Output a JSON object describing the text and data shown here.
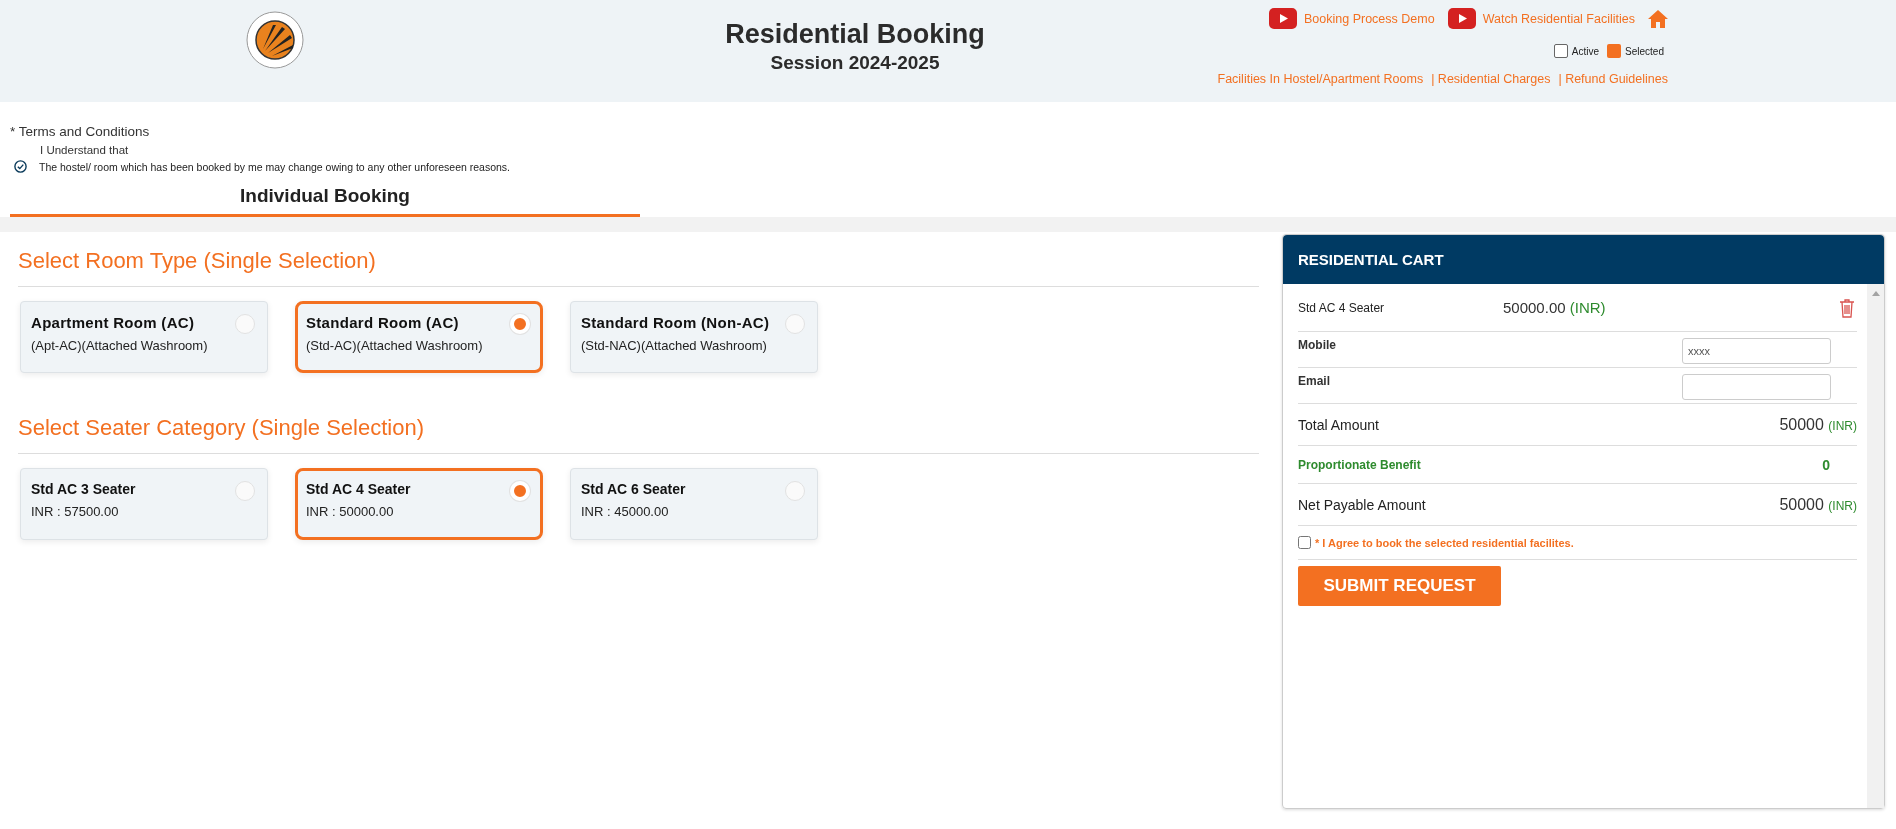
{
  "header": {
    "title": "Residential Booking",
    "subtitle": "Session 2024-2025",
    "video_links": [
      {
        "label": "Booking Process Demo"
      },
      {
        "label": "Watch Residential Facilities"
      }
    ],
    "legend": [
      {
        "label": "Active",
        "kind": "active"
      },
      {
        "label": "Selected",
        "kind": "selected"
      }
    ],
    "info_links": [
      "Facilities In Hostel/Apartment Rooms",
      "| Residential Charges",
      "| Refund Guidelines"
    ]
  },
  "terms": {
    "title": "* Terms and Conditions",
    "intro": "I Understand that",
    "items": [
      "The hostel/ room which has been booked by me may change owing to any other unforeseen reasons."
    ]
  },
  "tabs": [
    {
      "label": "Individual Booking",
      "selected": true
    }
  ],
  "room_type": {
    "heading": "Select Room Type (Single Selection)",
    "options": [
      {
        "title": "Apartment Room (AC)",
        "subtitle": "(Apt-AC)(Attached Washroom)",
        "selected": false
      },
      {
        "title": "Standard Room (AC)",
        "subtitle": "(Std-AC)(Attached Washroom)",
        "selected": true
      },
      {
        "title": "Standard Room (Non-AC)",
        "subtitle": "(Std-NAC)(Attached Washroom)",
        "selected": false
      }
    ]
  },
  "seater": {
    "heading": "Select Seater Category (Single Selection)",
    "options": [
      {
        "title": "Std AC 3 Seater",
        "subtitle": "INR : 57500.00",
        "selected": false
      },
      {
        "title": "Std AC 4 Seater",
        "subtitle": "INR : 50000.00",
        "selected": true
      },
      {
        "title": "Std AC 6 Seater",
        "subtitle": "INR : 45000.00",
        "selected": false
      }
    ]
  },
  "cart": {
    "title": "RESIDENTIAL CART",
    "item": {
      "name": "Std AC 4 Seater",
      "amount": "50000.00",
      "currency": "(INR)"
    },
    "fields": [
      {
        "label": "Mobile",
        "placeholder": "xxxx"
      },
      {
        "label": "Email"
      }
    ],
    "total": {
      "label": "Total Amount",
      "amount": "50000",
      "currency": "(INR)"
    },
    "benefit": {
      "label": "Proportionate Benefit",
      "amount": "0"
    },
    "net": {
      "label": "Net Payable Amount",
      "amount": "50000",
      "currency": "(INR)"
    },
    "agree": {
      "label": "* I Agree to book the selected residential facilites.",
      "checked": false
    },
    "submit": "SUBMIT REQUEST"
  }
}
